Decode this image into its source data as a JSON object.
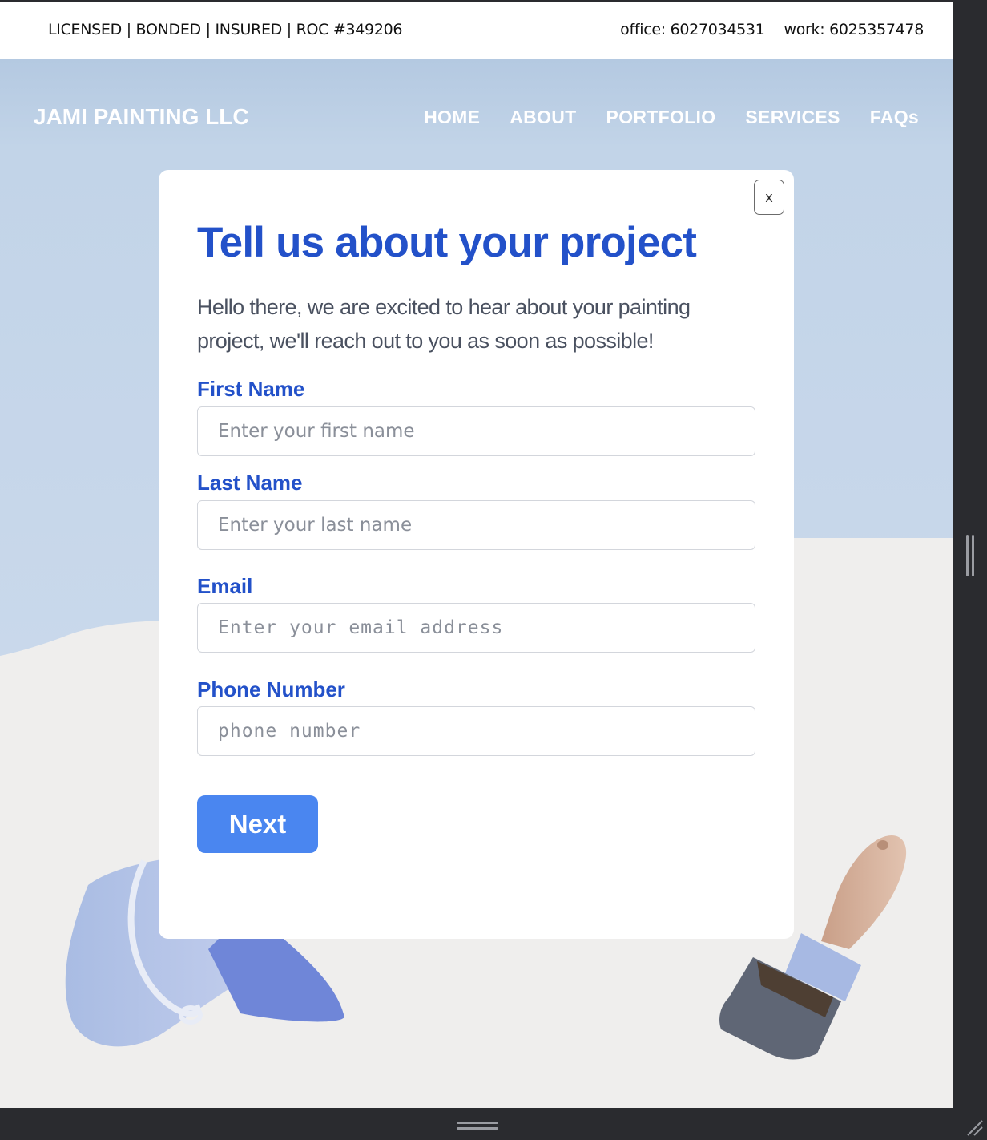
{
  "topbar": {
    "license": "LICENSED | BONDED | INSURED | ROC #349206",
    "office": "office: 6027034531",
    "work": "work: 6025357478"
  },
  "header": {
    "brand": "JAMI PAINTING LLC",
    "nav": [
      "HOME",
      "ABOUT",
      "PORTFOLIO",
      "SERVICES",
      "FAQs"
    ]
  },
  "modal": {
    "close_label": "x",
    "title": "Tell us about your project",
    "intro": "Hello there, we are excited to hear about your painting project, we'll reach out to you as soon as possible!",
    "first_name": {
      "label": "First Name",
      "placeholder": "Enter your first name",
      "value": ""
    },
    "last_name": {
      "label": "Last Name",
      "placeholder": "Enter your last name",
      "value": ""
    },
    "email": {
      "label": "Email",
      "placeholder": "Enter your email address",
      "value": ""
    },
    "phone": {
      "label": "Phone Number",
      "placeholder": "phone number",
      "value": ""
    },
    "next_label": "Next"
  },
  "illustrations": [
    "paint-bucket-icon",
    "paint-brush-icon"
  ],
  "colors": {
    "accent": "#2351c9",
    "button": "#4a86f0",
    "sky_top": "#b4c9e1",
    "ground": "#efeeed"
  }
}
